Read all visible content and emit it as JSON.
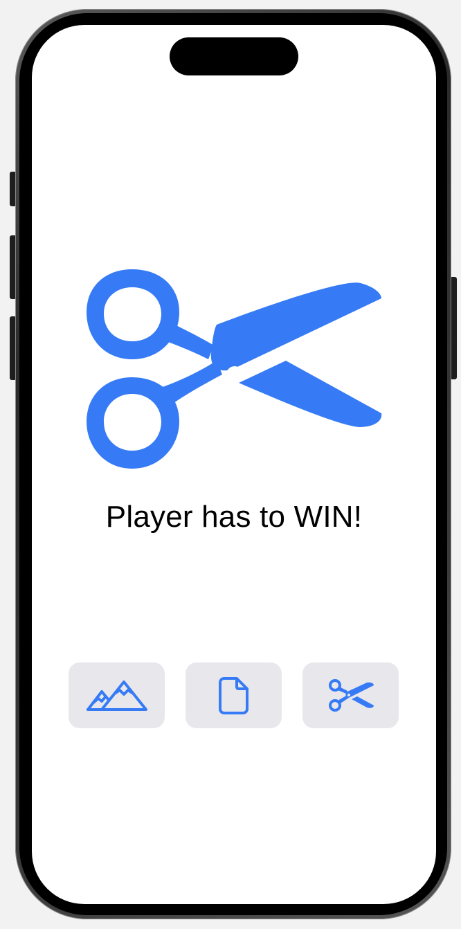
{
  "game": {
    "result_text": "Player has to WIN!",
    "hero_icon": "scissors-icon"
  },
  "choices": [
    {
      "name": "rock",
      "icon": "mountains-icon"
    },
    {
      "name": "paper",
      "icon": "document-icon"
    },
    {
      "name": "scissors",
      "icon": "scissors-icon"
    }
  ],
  "colors": {
    "accent": "#367bf5",
    "button_background": "#e8e8ec",
    "screen_background": "#ffffff",
    "text": "#000000"
  }
}
